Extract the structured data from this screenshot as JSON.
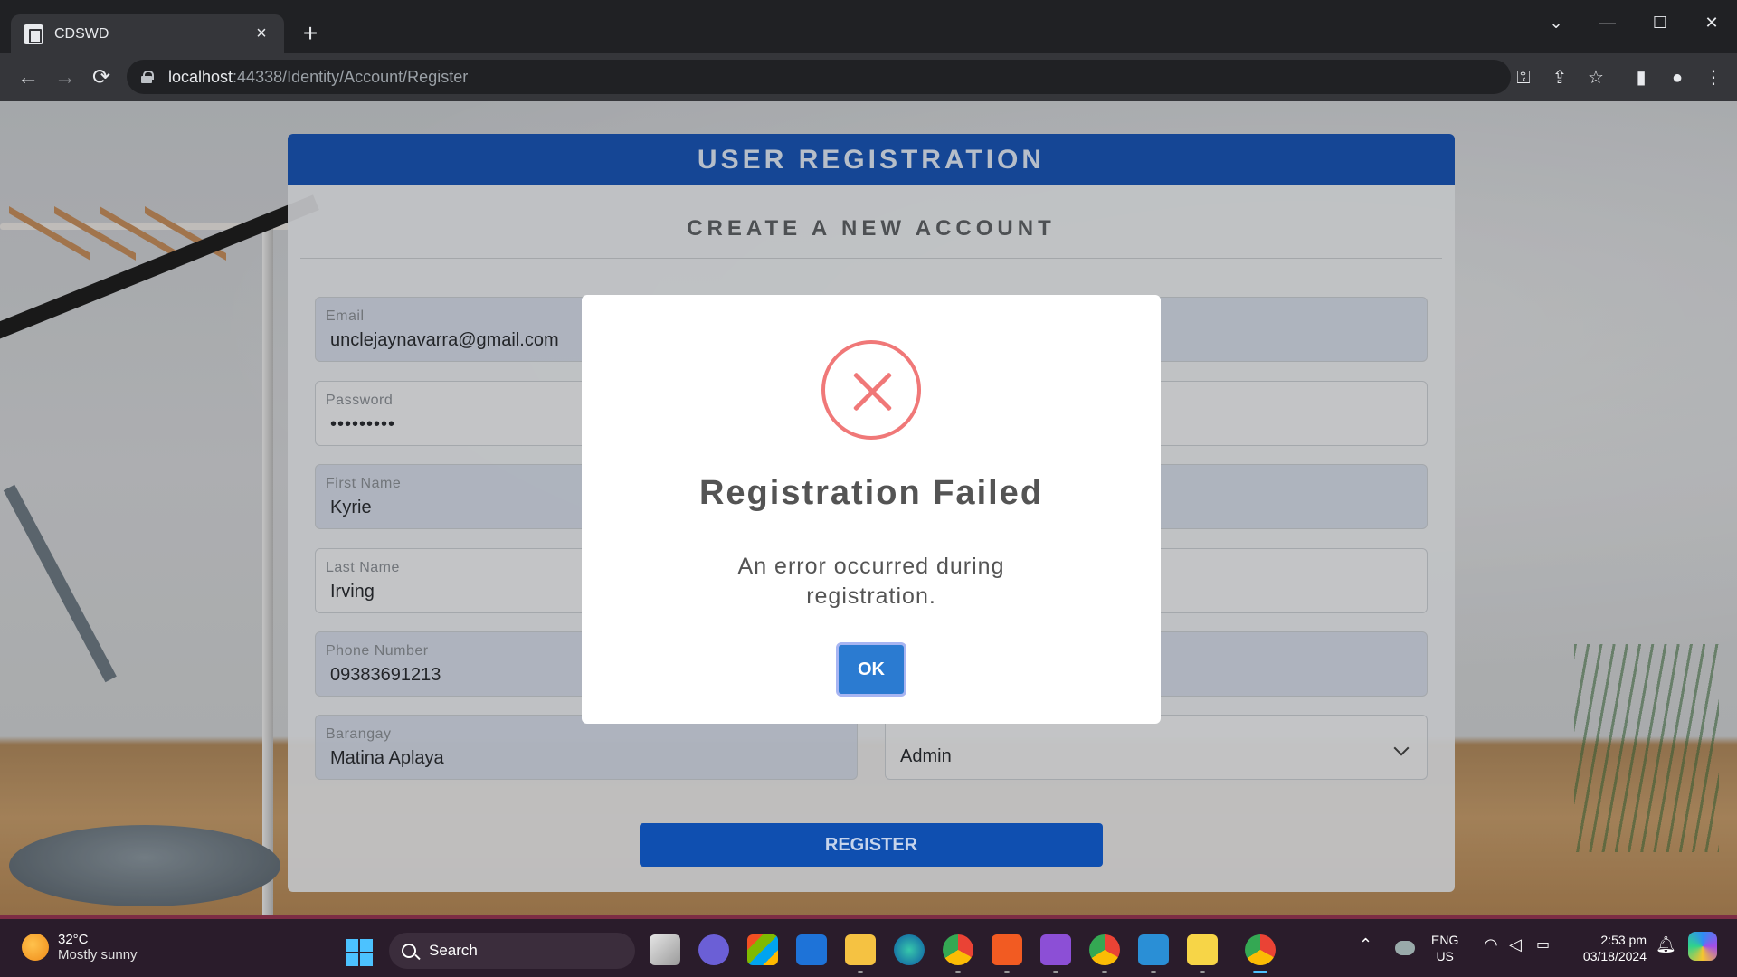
{
  "browser": {
    "tab_title": "CDSWD",
    "tab_close": "×",
    "new_tab": "+",
    "url_host": "localhost",
    "url_path": ":44338/Identity/Account/Register"
  },
  "icons": {
    "back": "←",
    "forward": "→",
    "reload": "⟳",
    "key": "⚿",
    "share": "⇪",
    "star": "☆",
    "sidebar": "▮",
    "profile": "●",
    "menu": "⋮",
    "tab_search": "⌄",
    "minimize": "—",
    "maximize": "☐",
    "close": "✕"
  },
  "card": {
    "title": "USER REGISTRATION",
    "subtitle": "CREATE A NEW ACCOUNT",
    "fields": {
      "email": {
        "label": "Email",
        "value": "unclejaynavarra@gmail.com"
      },
      "password": {
        "label": "Password",
        "value": "•••••••••"
      },
      "first_name": {
        "label": "First Name",
        "value": "Kyrie"
      },
      "last_name": {
        "label": "Last Name",
        "value": "Irving"
      },
      "phone": {
        "label": "Phone Number",
        "value": "09383691213"
      },
      "barangay": {
        "label": "Barangay",
        "value": "Matina Aplaya"
      },
      "role": {
        "value": "Admin"
      }
    },
    "register_label": "REGISTER"
  },
  "modal": {
    "title": "Registration Failed",
    "message": "An error occurred during registration.",
    "ok_label": "OK"
  },
  "taskbar": {
    "weather_temp": "32°C",
    "weather_condition": "Mostly sunny",
    "search_label": "Search",
    "language_line1": "ENG",
    "language_line2": "US",
    "time": "2:53 pm",
    "date": "03/18/2024"
  },
  "colors": {
    "header_blue": "#1a56b6",
    "error_red": "#f07878",
    "ok_blue": "#2b7bd1"
  }
}
